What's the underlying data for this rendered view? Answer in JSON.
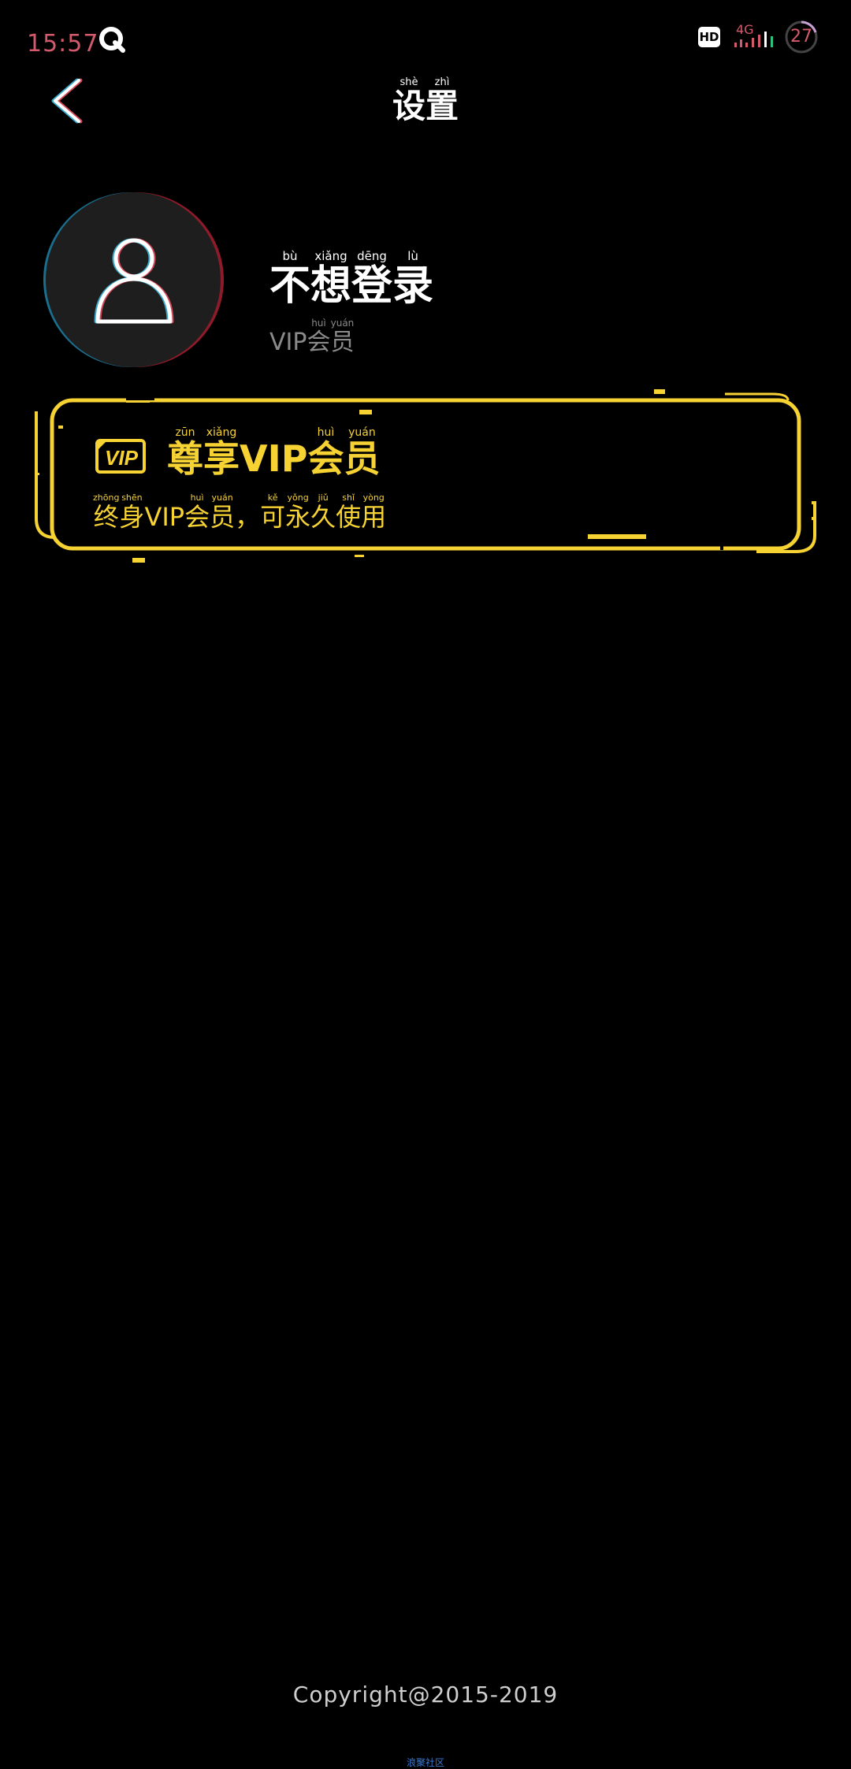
{
  "status_bar": {
    "time": "15:57",
    "hd_label": "HD",
    "network_type": "4G",
    "battery": "27",
    "app_icon": "q-app-icon",
    "time_color": "#d25a6a"
  },
  "nav": {
    "back_icon": "chevron-left-icon",
    "title_chars": [
      "设",
      "置"
    ],
    "title_pinyin": [
      "shè",
      "zhì"
    ]
  },
  "profile": {
    "avatar_icon": "user-outline-icon",
    "username_chars": [
      "不",
      "想",
      "登",
      "录"
    ],
    "username_pinyin": [
      "bù",
      "xiǎng",
      "dēng",
      "lù"
    ],
    "member_prefix": "VIP",
    "member_chars": [
      "会",
      "员"
    ],
    "member_pinyin": [
      "huì",
      "yuán"
    ]
  },
  "vip_card": {
    "badge_icon": "vip-badge-icon",
    "badge_text": "VIP",
    "title_chars_1": [
      "尊",
      "享"
    ],
    "title_pinyin_1": [
      "zūn",
      "xiǎng"
    ],
    "title_vip": "VIP",
    "title_chars_2": [
      "会",
      "员"
    ],
    "title_pinyin_2": [
      "huì",
      "yuán"
    ],
    "desc_chars_1": [
      "终",
      "身"
    ],
    "desc_pinyin_1": [
      "zhōng",
      "shēn"
    ],
    "desc_vip": "VIP",
    "desc_chars_2": [
      "会",
      "员"
    ],
    "desc_pinyin_2": [
      "huì",
      "yuán"
    ],
    "desc_sep": "，",
    "desc_chars_3": [
      "可",
      "永",
      "久",
      "使",
      "用"
    ],
    "desc_pinyin_3": [
      "kě",
      "yǒng",
      "jiǔ",
      "shǐ",
      "yòng"
    ],
    "accent_color": "#f7d233"
  },
  "footer": {
    "copyright": "Copyright@2015-2019",
    "bottom_link": "浪聚社区"
  }
}
